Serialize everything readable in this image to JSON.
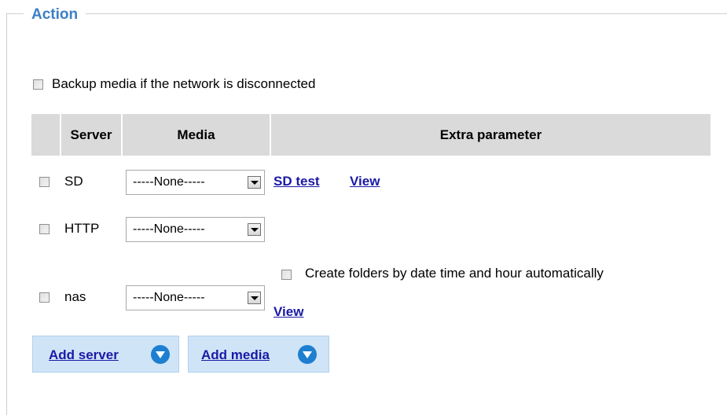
{
  "section": {
    "legend": "Action"
  },
  "backup": {
    "label": "Backup media if the network is disconnected",
    "checked": false
  },
  "table": {
    "headers": {
      "server": "Server",
      "media": "Media",
      "extra": "Extra parameter"
    },
    "rows": [
      {
        "server": "SD",
        "media": "-----None-----",
        "links": [
          "SD test",
          "View"
        ]
      },
      {
        "server": "HTTP",
        "media": "-----None-----"
      },
      {
        "server": "nas",
        "media": "-----None-----",
        "option_label": "Create folders by date time and hour automatically",
        "view_label": "View"
      }
    ]
  },
  "buttons": {
    "add_server": "Add server",
    "add_media": "Add media"
  },
  "colors": {
    "accent": "#3c7fc6",
    "link": "#1a1aa6",
    "header_bg": "#dadada",
    "button_bg": "#cfe4f7",
    "icon": "#1e7fd0"
  }
}
